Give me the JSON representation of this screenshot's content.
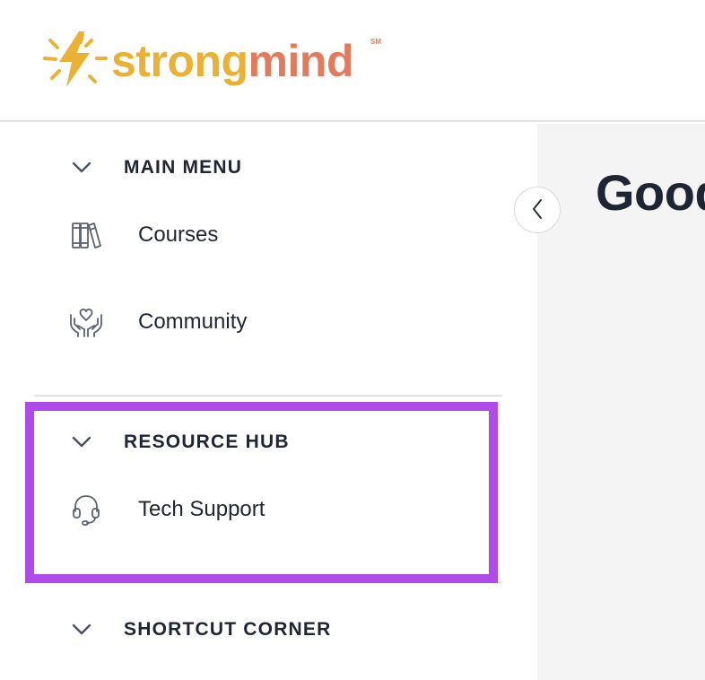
{
  "brand": {
    "logo_part1": "strong",
    "logo_part2": "mind",
    "trademark": "SM",
    "colors": {
      "yellow": "#ebb134",
      "coral": "#e37a5b"
    }
  },
  "sidebar": {
    "sections": [
      {
        "title": "MAIN MENU",
        "items": [
          {
            "label": "Courses",
            "icon": "books-icon"
          },
          {
            "label": "Community",
            "icon": "heart-hands-icon"
          }
        ]
      },
      {
        "title": "RESOURCE HUB",
        "items": [
          {
            "label": "Tech Support",
            "icon": "headset-icon"
          }
        ]
      },
      {
        "title": "SHORTCUT CORNER",
        "items": []
      }
    ],
    "collapse_icon": "chevron-left-icon",
    "highlight_color": "#b04ae8"
  },
  "main": {
    "greeting": "Good"
  }
}
